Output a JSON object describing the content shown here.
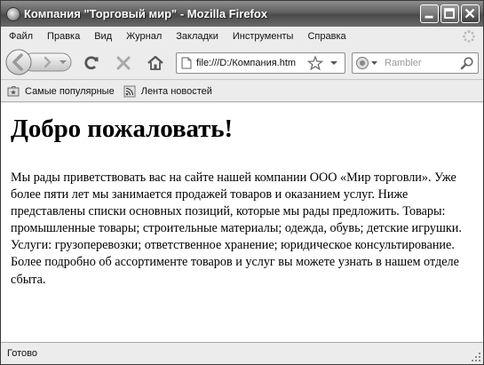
{
  "window": {
    "title": "Компания \"Торговый мир\" - Mozilla Firefox"
  },
  "menu": {
    "items": [
      "Файл",
      "Правка",
      "Вид",
      "Журнал",
      "Закладки",
      "Инструменты",
      "Справка"
    ]
  },
  "navigation": {
    "url": "file:///D:/Компания.htm",
    "search_placeholder": "Rambler"
  },
  "bookmarks": {
    "items": [
      "Самые популярные",
      "Лента новостей"
    ]
  },
  "page": {
    "heading": "Добро пожаловать!",
    "paragraph": "Мы рады приветствовать вас на сайте нашей компании ООО «Мир торговли». Уже более пяти лет мы занимается продажей товаров и оказанием услуг. Ниже представлены списки основных позиций, которые мы рады предложить. Товары: промышленные товары; строительные материалы; одежда, обувь; детские игрушки. Услуги: грузоперевозки; ответственное хранение; юридическое консультирование. Более подробно об ассортименте товаров и услуг вы можете узнать в нашем отделе сбыта."
  },
  "status": {
    "text": "Готово"
  },
  "icons": {
    "app": "firefox-icon",
    "minimize": "minimize-icon",
    "maximize": "maximize-icon",
    "close": "close-icon",
    "back": "back-arrow-icon",
    "forward": "forward-arrow-icon",
    "reload": "reload-icon",
    "stop": "stop-icon",
    "home": "home-icon",
    "page": "page-icon",
    "bookmark_star": "star-icon",
    "search_go": "magnifier-icon",
    "most_visited": "bookmark-folder-icon",
    "news_feed": "rss-feed-icon"
  }
}
